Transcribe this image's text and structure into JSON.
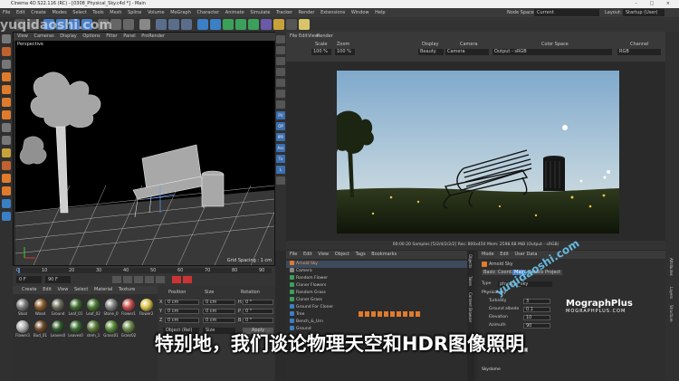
{
  "window": {
    "title": "Cinema 4D S22.116 (RC) - [0308_Physical_Sky.c4d *] - Main",
    "controls": [
      "–",
      "□",
      "×"
    ]
  },
  "menubar": {
    "items": [
      "File",
      "Edit",
      "Create",
      "Modes",
      "Select",
      "Tools",
      "Mesh",
      "Spline",
      "Volume",
      "MoGraph",
      "Character",
      "Animate",
      "Simulate",
      "Tracker",
      "Render",
      "Extensions",
      "Window",
      "Help"
    ],
    "node_space_label": "Node Space:",
    "node_space_value": "Current (Standard/Physical)",
    "layout_label": "Layout:",
    "layout_value": "Startup (User)"
  },
  "viewport": {
    "menu": [
      "View",
      "Cameras",
      "Display",
      "Options",
      "Filter",
      "Panel",
      "ProRender"
    ],
    "label": "Perspective",
    "grid_spacing": "Grid Spacing : 1 cm"
  },
  "timeline": {
    "ticks": [
      "0",
      "10",
      "20",
      "30",
      "40",
      "50",
      "60",
      "70",
      "80",
      "90"
    ],
    "start": "0 F",
    "end": "90 F",
    "current": "0 F"
  },
  "materials": {
    "menu": [
      "Create",
      "Edit",
      "View",
      "Select",
      "Material",
      "Texture"
    ],
    "row1": [
      "Stool",
      "Wood",
      "Ground",
      "Leaf_01",
      "Leaf_02",
      "Stone_0",
      "Flower1",
      "Flower2"
    ],
    "row2": [
      "Flower3",
      "Bud_01",
      "Leaves0",
      "Leaves0",
      "stem_1",
      "Grass01",
      "Grass02",
      ""
    ]
  },
  "coords": {
    "headers": [
      "Position",
      "Size",
      "Rotation"
    ],
    "rows": [
      {
        "axis": "X",
        "pos": "0 cm",
        "size": "0 cm",
        "rotlabel": "H",
        "rot": "0 °"
      },
      {
        "axis": "Y",
        "pos": "0 cm",
        "size": "0 cm",
        "rotlabel": "P",
        "rot": "0 °"
      },
      {
        "axis": "Z",
        "pos": "0 cm",
        "size": "0 cm",
        "rotlabel": "B",
        "rot": "0 °"
      }
    ],
    "mode": "Object (Rel)",
    "size_mode": "Size",
    "apply": "Apply"
  },
  "sidetools": [
    "PV",
    "OP",
    "IPR",
    "Ass",
    "Tx",
    "L"
  ],
  "renderview": {
    "menu": [
      "File",
      "Edit",
      "View",
      "Render"
    ],
    "headers": [
      "Scale",
      "Zoom",
      "Display",
      "Camera",
      "Color Space",
      "Channel"
    ],
    "values": [
      "100 %",
      "100 %",
      "Beauty",
      "Camera",
      "Output - sRGB",
      "RGB"
    ],
    "status": "00:00:20  Samples [5/2/4/2/2/2]  Res: 800x450  Mem: 2598.68 MiB  (Output - sRGB)"
  },
  "objects": {
    "menu": [
      "File",
      "Edit",
      "View",
      "Object",
      "Tags",
      "Bookmarks"
    ],
    "items": [
      "Arnold Sky",
      "Camera",
      "Random Flower",
      "Cloner Flowers",
      "Random Grass",
      "Cloner Grass",
      "Ground For Cloner",
      "Tree",
      "Bench_&_Urn",
      "Ground"
    ]
  },
  "attributes": {
    "menu": [
      "Mode",
      "Edit",
      "User Data"
    ],
    "object": "Arnold Sky",
    "tabs": [
      "Basic",
      "Coord.",
      "Main",
      "Details",
      "Project"
    ],
    "type_label": "Type",
    "type_value": "physical_sky",
    "section": "Physical sky",
    "params": [
      {
        "name": "Turbidity",
        "value": "3"
      },
      {
        "name": "Ground albedo",
        "value": "0.1"
      },
      {
        "name": "Elevation",
        "value": "10"
      },
      {
        "name": "Azimuth",
        "value": "90"
      }
    ],
    "enable_sun": "Enable sun",
    "skydome": "Skydome"
  },
  "side_tabs": [
    "Attributes",
    "Layers",
    "Structure"
  ],
  "left_tabs": [
    "Objects",
    "Takes",
    "Content Browser"
  ],
  "subtitle": "特别地，我们谈论物理天空和HDR图像照明",
  "watermarks": {
    "top": "yuqidaoshi.com",
    "diag": "yuqidaoshi.com",
    "brand1": "MographPlus",
    "brand2": "MOGRAPHPLUS.COM"
  },
  "colors": {
    "accent": "#3b7fc4",
    "active_blue": "#4a7fc6",
    "orange": "#e07b2c"
  }
}
